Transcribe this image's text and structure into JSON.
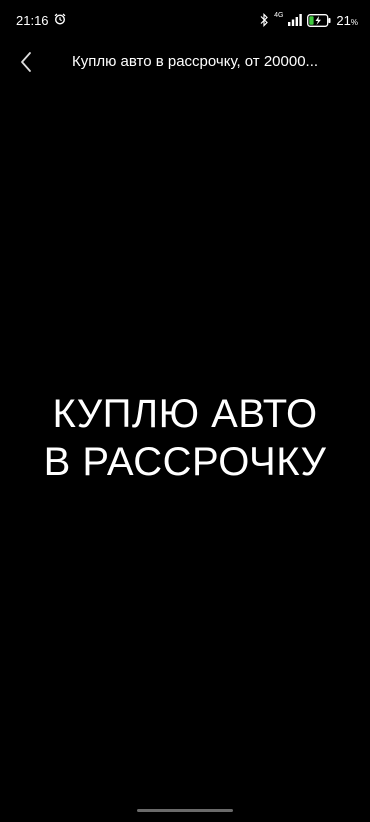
{
  "status_bar": {
    "time": "21:16",
    "network": "4G",
    "battery_percent": "21",
    "battery_unit": "%",
    "icons": [
      "alarm-icon",
      "bluetooth-icon",
      "signal-icon",
      "battery-charging-icon"
    ]
  },
  "top_bar": {
    "title": "Куплю авто в рассрочку, от 20000...",
    "back_icon": "chevron-left-icon"
  },
  "media": {
    "line1": "КУПЛЮ АВТО",
    "line2": "В РАССРОЧКУ",
    "background_color": "#000000",
    "text_color": "#ffffff"
  }
}
